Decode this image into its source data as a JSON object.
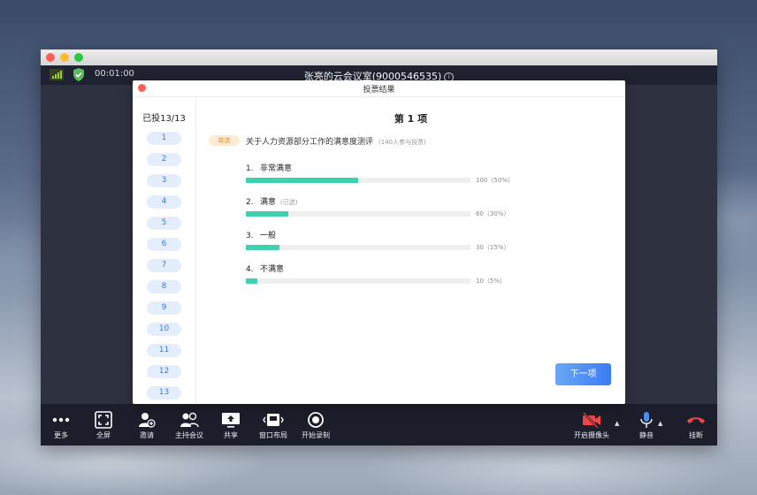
{
  "meeting": {
    "timer": "00:01:00",
    "title": "张亮的云会议室(9000546535)",
    "info_icon": "i"
  },
  "toolbar": {
    "left": [
      {
        "icon": "more-icon",
        "label": "更多"
      },
      {
        "icon": "fullscreen-icon",
        "label": "全屏"
      },
      {
        "icon": "invite-icon",
        "label": "邀请"
      },
      {
        "icon": "host-icon",
        "label": "主持会议"
      },
      {
        "icon": "share-icon",
        "label": "共享"
      },
      {
        "icon": "layout-icon",
        "label": "窗口布局"
      },
      {
        "icon": "record-icon",
        "label": "开始录制"
      }
    ],
    "camera_label": "开启摄像头",
    "mic_label": "静音",
    "hangup_label": "挂断",
    "caret": "▲"
  },
  "dialog": {
    "title": "投票结果",
    "voted": "已投13/13",
    "questions": [
      "1",
      "2",
      "3",
      "4",
      "5",
      "6",
      "7",
      "8",
      "9",
      "10",
      "11",
      "12",
      "13"
    ],
    "heading": "第 1 项",
    "badge": "单选",
    "question_text": "关于人力资源部分工作的满意度测评",
    "question_count": "(140人参与投票)",
    "options": [
      {
        "num": "1.",
        "label": "非常满意",
        "selected_note": "",
        "fraction": 0.5,
        "stat": "100（50%）"
      },
      {
        "num": "2.",
        "label": "满意",
        "selected_note": "(已选)",
        "fraction": 0.19,
        "stat": "60（30%）"
      },
      {
        "num": "3.",
        "label": "一般",
        "selected_note": "",
        "fraction": 0.15,
        "stat": "30（15%）"
      },
      {
        "num": "4.",
        "label": "不满意",
        "selected_note": "",
        "fraction": 0.05,
        "stat": "10（5%）"
      }
    ],
    "next_button": "下一项"
  },
  "colors": {
    "accent_blue": "#3a79f2",
    "bar_fill": "#3fd0b0",
    "badge_text": "#e8912c",
    "hangup_red": "#f04848"
  }
}
